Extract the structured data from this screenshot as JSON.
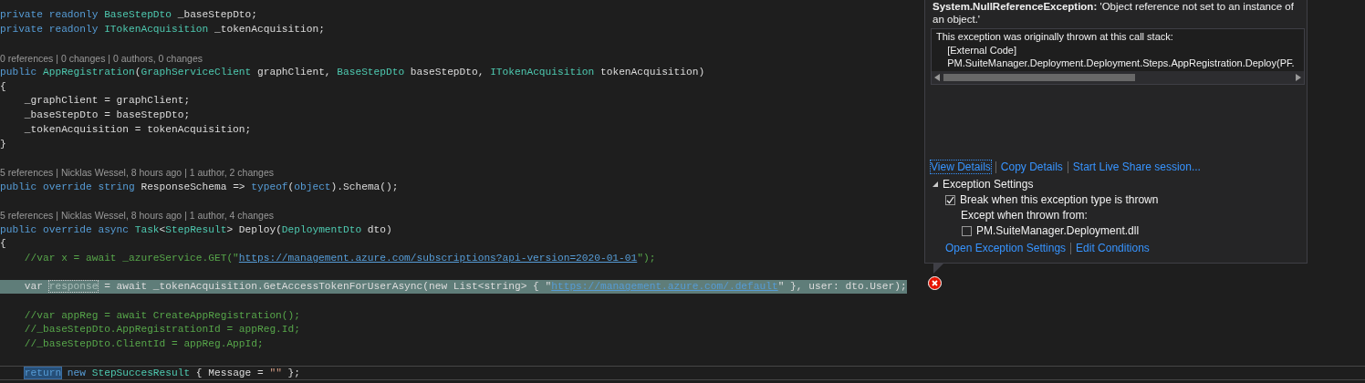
{
  "code_lines": [
    {
      "kind": "code",
      "tokens": [
        {
          "text": "private readonly ",
          "kind": "kw"
        },
        {
          "text": "BaseStepDto",
          "kind": "type"
        },
        {
          "text": " _baseStepDto;",
          "kind": "id"
        }
      ]
    },
    {
      "kind": "code",
      "tokens": [
        {
          "text": "private readonly ",
          "kind": "kw"
        },
        {
          "text": "ITokenAcquisition",
          "kind": "type"
        },
        {
          "text": " _tokenAcquisition;",
          "kind": "id"
        }
      ]
    },
    {
      "kind": "blank"
    },
    {
      "kind": "lens",
      "text": "0 references | 0 changes | 0 authors, 0 changes"
    },
    {
      "kind": "code",
      "tokens": [
        {
          "text": "public ",
          "kind": "kw"
        },
        {
          "text": "AppRegistration",
          "kind": "type"
        },
        {
          "text": "(",
          "kind": "id"
        },
        {
          "text": "GraphServiceClient",
          "kind": "type"
        },
        {
          "text": " graphClient, ",
          "kind": "id"
        },
        {
          "text": "BaseStepDto",
          "kind": "type"
        },
        {
          "text": " baseStepDto, ",
          "kind": "id"
        },
        {
          "text": "ITokenAcquisition",
          "kind": "type"
        },
        {
          "text": " tokenAcquisition)",
          "kind": "id"
        }
      ]
    },
    {
      "kind": "code",
      "tokens": [
        {
          "text": "{",
          "kind": "id"
        }
      ]
    },
    {
      "kind": "code",
      "tokens": [
        {
          "text": "    _graphClient = graphClient;",
          "kind": "id"
        }
      ]
    },
    {
      "kind": "code",
      "tokens": [
        {
          "text": "    _baseStepDto = baseStepDto;",
          "kind": "id"
        }
      ]
    },
    {
      "kind": "code",
      "tokens": [
        {
          "text": "    _tokenAcquisition = tokenAcquisition;",
          "kind": "id"
        }
      ]
    },
    {
      "kind": "code",
      "tokens": [
        {
          "text": "}",
          "kind": "id"
        }
      ]
    },
    {
      "kind": "blank"
    },
    {
      "kind": "lens",
      "text": "5 references | Nicklas Wessel, 8 hours ago | 1 author, 2 changes"
    },
    {
      "kind": "code",
      "tokens": [
        {
          "text": "public override string ",
          "kind": "kw"
        },
        {
          "text": "ResponseSchema => ",
          "kind": "id"
        },
        {
          "text": "typeof",
          "kind": "kw"
        },
        {
          "text": "(",
          "kind": "id"
        },
        {
          "text": "object",
          "kind": "kw"
        },
        {
          "text": ").Schema();",
          "kind": "id"
        }
      ]
    },
    {
      "kind": "blank"
    },
    {
      "kind": "lens",
      "text": "5 references | Nicklas Wessel, 8 hours ago | 1 author, 4 changes"
    },
    {
      "kind": "code",
      "tokens": [
        {
          "text": "public override async ",
          "kind": "kw"
        },
        {
          "text": "Task",
          "kind": "type"
        },
        {
          "text": "<",
          "kind": "id"
        },
        {
          "text": "StepResult",
          "kind": "type"
        },
        {
          "text": "> Deploy(",
          "kind": "id"
        },
        {
          "text": "DeploymentDto",
          "kind": "type"
        },
        {
          "text": " dto)",
          "kind": "id"
        }
      ]
    },
    {
      "kind": "code",
      "tokens": [
        {
          "text": "{",
          "kind": "id"
        }
      ]
    },
    {
      "kind": "code",
      "tokens": [
        {
          "text": "    //var x = await _azureService.GET(\"",
          "kind": "comment"
        },
        {
          "text": "https://management.azure.com/subscriptions?api-version=2020-01-01",
          "kind": "link"
        },
        {
          "text": "\");",
          "kind": "comment"
        }
      ]
    },
    {
      "kind": "blank"
    },
    {
      "kind": "highlighted",
      "tokens": [
        {
          "text": "    var ",
          "kind": "id"
        },
        {
          "text": "response",
          "kind": "focus"
        },
        {
          "text": " = await _tokenAcquisition.GetAccessTokenForUserAsync(new List<string> { \"",
          "kind": "id"
        },
        {
          "text": "https://management.azure.com/.default",
          "kind": "link"
        },
        {
          "text": "\" }, user: dto.User);",
          "kind": "id"
        }
      ]
    },
    {
      "kind": "blank"
    },
    {
      "kind": "code",
      "tokens": [
        {
          "text": "    //var appReg = await CreateAppRegistration();",
          "kind": "comment"
        }
      ]
    },
    {
      "kind": "code",
      "tokens": [
        {
          "text": "    //_baseStepDto.AppRegistrationId = appReg.Id;",
          "kind": "comment"
        }
      ]
    },
    {
      "kind": "code",
      "tokens": [
        {
          "text": "    //_baseStepDto.ClientId = appReg.AppId;",
          "kind": "comment"
        }
      ]
    },
    {
      "kind": "blank"
    },
    {
      "kind": "current",
      "tokens": [
        {
          "text": "    return",
          "kind": "selection"
        },
        {
          "text": " new ",
          "kind": "kw"
        },
        {
          "text": "StepSuccesResult",
          "kind": "type"
        },
        {
          "text": " { Message = ",
          "kind": "id"
        },
        {
          "text": "\"\"",
          "kind": "str"
        },
        {
          "text": " };",
          "kind": "id"
        }
      ]
    }
  ],
  "exception": {
    "title": "**System.NullReferenceException:** 'Object reference not set to an instance of an object.'",
    "call_stack": [
      "This exception was originally thrown at this call stack:",
      "    [External Code]",
      "    PM.SuiteManager.Deployment.Deployment.Steps.AppRegistration.Deploy(PF."
    ],
    "actions": [
      {
        "label": "View Details",
        "focused": true
      },
      {
        "label": "Copy Details",
        "focused": false
      },
      {
        "label": "Start Live Share session...",
        "focused": false
      }
    ],
    "settings": {
      "label": "Exception Settings",
      "expanded": true,
      "options": [
        {
          "kind": "checkbox",
          "label": "Break when this exception type is thrown",
          "checked": true
        },
        {
          "kind": "text",
          "label": "Except when thrown from:"
        },
        {
          "kind": "checkbox",
          "label": "PM.SuiteManager.Deployment.dll",
          "checked": false,
          "nested": true
        }
      ],
      "links": [
        "Open Exception Settings",
        "Edit Conditions"
      ]
    }
  }
}
